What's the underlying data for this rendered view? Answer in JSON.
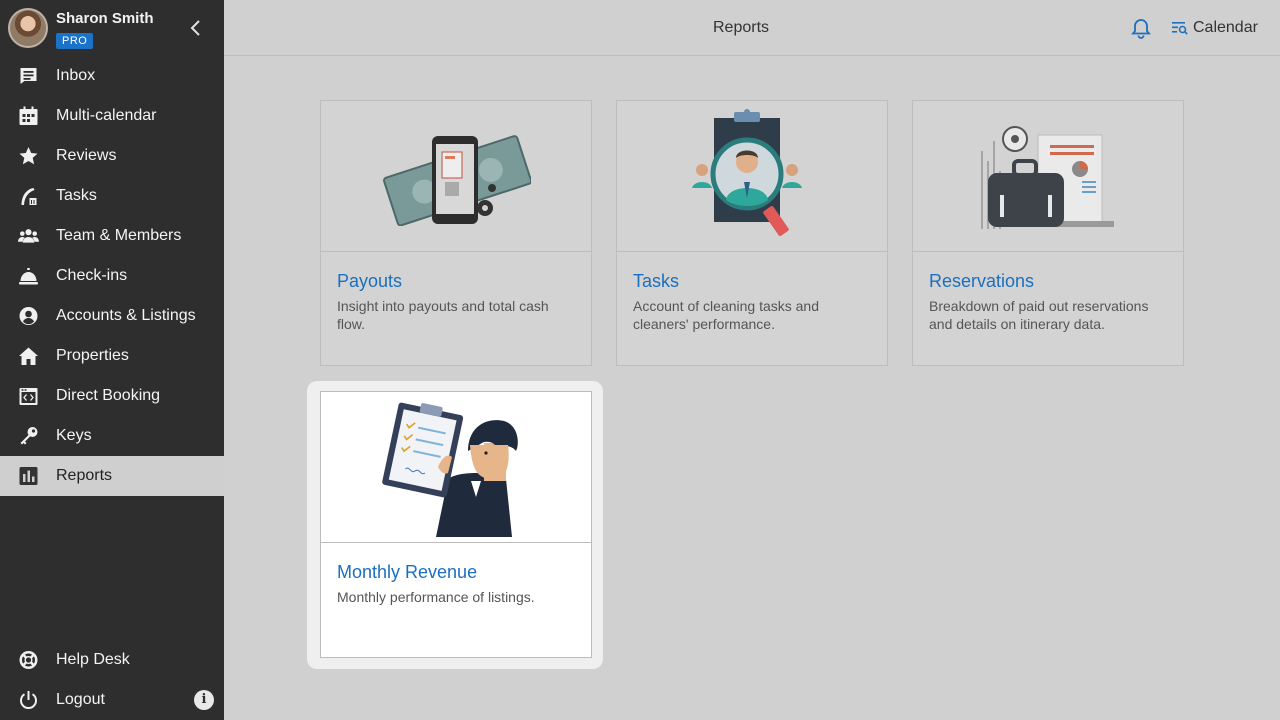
{
  "user": {
    "name": "Sharon Smith",
    "badge": "PRO"
  },
  "nav": [
    {
      "label": "Inbox",
      "icon": "inbox-icon"
    },
    {
      "label": "Multi-calendar",
      "icon": "calendar-grid-icon"
    },
    {
      "label": "Reviews",
      "icon": "star-icon"
    },
    {
      "label": "Tasks",
      "icon": "broom-icon"
    },
    {
      "label": "Team & Members",
      "icon": "team-icon"
    },
    {
      "label": "Check-ins",
      "icon": "bell-desk-icon"
    },
    {
      "label": "Accounts & Listings",
      "icon": "account-circle-icon"
    },
    {
      "label": "Properties",
      "icon": "home-icon"
    },
    {
      "label": "Direct Booking",
      "icon": "code-window-icon"
    },
    {
      "label": "Keys",
      "icon": "key-icon"
    },
    {
      "label": "Reports",
      "icon": "bar-chart-icon",
      "active": true
    }
  ],
  "bottom_nav": [
    {
      "label": "Help Desk",
      "icon": "lifebuoy-icon"
    },
    {
      "label": "Logout",
      "icon": "power-icon"
    }
  ],
  "info_glyph": "i",
  "header": {
    "title": "Reports",
    "calendar_label": "Calendar"
  },
  "colors": {
    "accent": "#1a6fbf",
    "sidebar": "#2e2e2e",
    "badge": "#1a73c9"
  },
  "reports": [
    {
      "title": "Payouts",
      "description": "Insight into payouts and total cash flow."
    },
    {
      "title": "Tasks",
      "description": "Account of cleaning tasks and cleaners' performance."
    },
    {
      "title": "Reservations",
      "description": "Breakdown of paid out reservations and details on itinerary data."
    },
    {
      "title": "Monthly Revenue",
      "description": "Monthly performance of listings."
    }
  ]
}
